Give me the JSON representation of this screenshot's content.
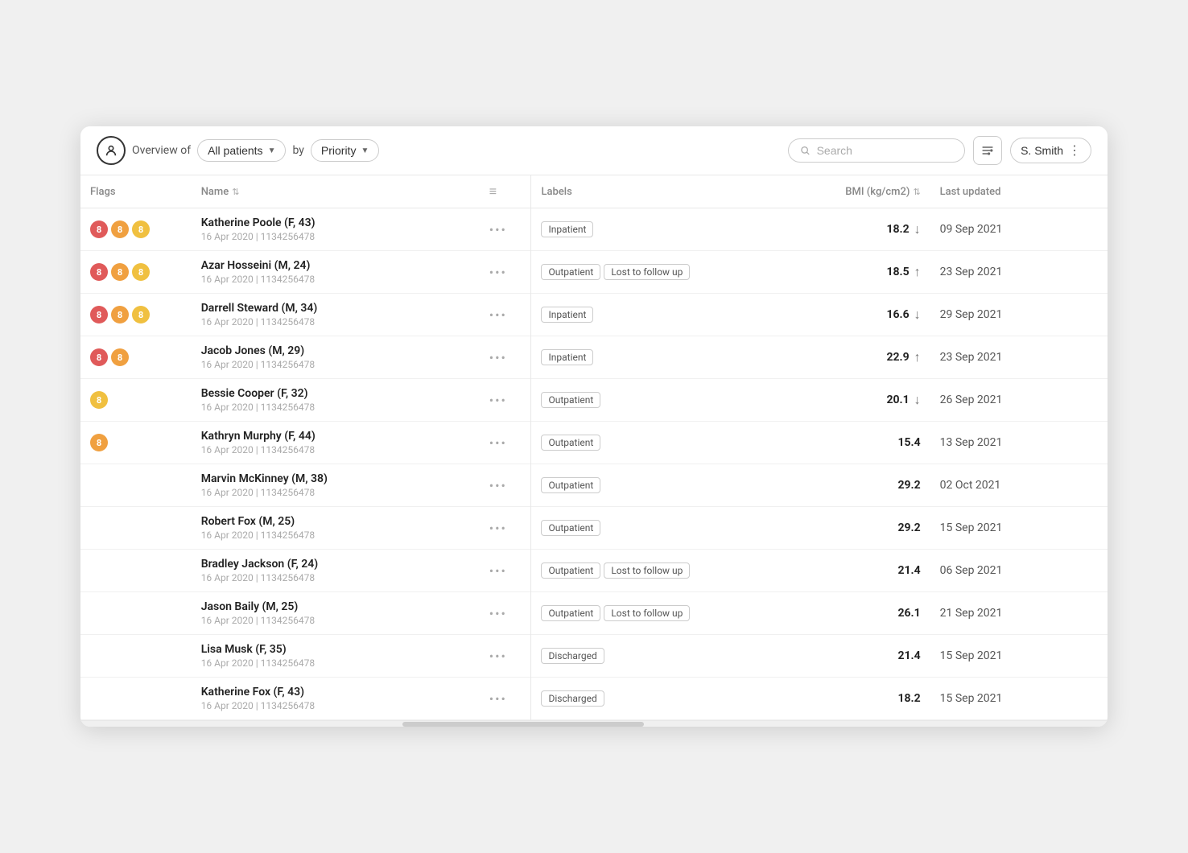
{
  "header": {
    "overview_text": "Overview of",
    "all_patients_label": "All patients",
    "by_text": "by",
    "priority_label": "Priority",
    "search_placeholder": "Search",
    "filter_label": "Filter",
    "user_label": "S. Smith"
  },
  "table": {
    "columns": {
      "flags": "Flags",
      "name": "Name",
      "labels": "Labels",
      "bmi": "BMI (kg/cm2)",
      "last_updated": "Last updated"
    },
    "rows": [
      {
        "flags": [
          "red",
          "orange",
          "yellow"
        ],
        "name": "Katherine Poole (F, 43)",
        "meta": "16 Apr 2020  |  1134256478",
        "labels": [
          "Inpatient"
        ],
        "bmi": "18.2",
        "bmi_trend": "down",
        "last_updated": "09 Sep 2021"
      },
      {
        "flags": [
          "red",
          "orange",
          "yellow"
        ],
        "name": "Azar Hosseini (M, 24)",
        "meta": "16 Apr 2020  |  1134256478",
        "labels": [
          "Outpatient",
          "Lost to follow up"
        ],
        "bmi": "18.5",
        "bmi_trend": "up",
        "last_updated": "23 Sep 2021"
      },
      {
        "flags": [
          "red",
          "orange",
          "yellow"
        ],
        "name": "Darrell Steward (M, 34)",
        "meta": "16 Apr 2020  |  1134256478",
        "labels": [
          "Inpatient"
        ],
        "bmi": "16.6",
        "bmi_trend": "down",
        "last_updated": "29 Sep 2021"
      },
      {
        "flags": [
          "red",
          "orange"
        ],
        "name": "Jacob Jones (M, 29)",
        "meta": "16 Apr 2020  |  1134256478",
        "labels": [
          "Inpatient"
        ],
        "bmi": "22.9",
        "bmi_trend": "up",
        "last_updated": "23 Sep 2021"
      },
      {
        "flags": [
          "yellow"
        ],
        "name": "Bessie Cooper (F, 32)",
        "meta": "16 Apr 2020  |  1134256478",
        "labels": [
          "Outpatient"
        ],
        "bmi": "20.1",
        "bmi_trend": "down",
        "last_updated": "26 Sep 2021"
      },
      {
        "flags": [
          "orange"
        ],
        "name": "Kathryn Murphy (F, 44)",
        "meta": "16 Apr 2020  |  1134256478",
        "labels": [
          "Outpatient"
        ],
        "bmi": "15.4",
        "bmi_trend": "none",
        "last_updated": "13 Sep 2021"
      },
      {
        "flags": [],
        "name": "Marvin McKinney (M, 38)",
        "meta": "16 Apr 2020  |  1134256478",
        "labels": [
          "Outpatient"
        ],
        "bmi": "29.2",
        "bmi_trend": "none",
        "last_updated": "02 Oct 2021"
      },
      {
        "flags": [],
        "name": "Robert Fox (M, 25)",
        "meta": "16 Apr 2020  |  1134256478",
        "labels": [
          "Outpatient"
        ],
        "bmi": "29.2",
        "bmi_trend": "none",
        "last_updated": "15 Sep 2021"
      },
      {
        "flags": [],
        "name": "Bradley Jackson (F, 24)",
        "meta": "16 Apr 2020  |  1134256478",
        "labels": [
          "Outpatient",
          "Lost to follow up"
        ],
        "bmi": "21.4",
        "bmi_trend": "none",
        "last_updated": "06 Sep 2021"
      },
      {
        "flags": [],
        "name": "Jason Baily (M, 25)",
        "meta": "16 Apr 2020  |  1134256478",
        "labels": [
          "Outpatient",
          "Lost to follow up"
        ],
        "bmi": "26.1",
        "bmi_trend": "none",
        "last_updated": "21 Sep 2021"
      },
      {
        "flags": [],
        "name": "Lisa Musk (F, 35)",
        "meta": "16 Apr 2020  |  1134256478",
        "labels": [
          "Discharged"
        ],
        "bmi": "21.4",
        "bmi_trend": "none",
        "last_updated": "15 Sep 2021"
      },
      {
        "flags": [],
        "name": "Katherine Fox (F, 43)",
        "meta": "16 Apr 2020  |  1134256478",
        "labels": [
          "Discharged"
        ],
        "bmi": "18.2",
        "bmi_trend": "none",
        "last_updated": "15 Sep 2021"
      }
    ]
  }
}
